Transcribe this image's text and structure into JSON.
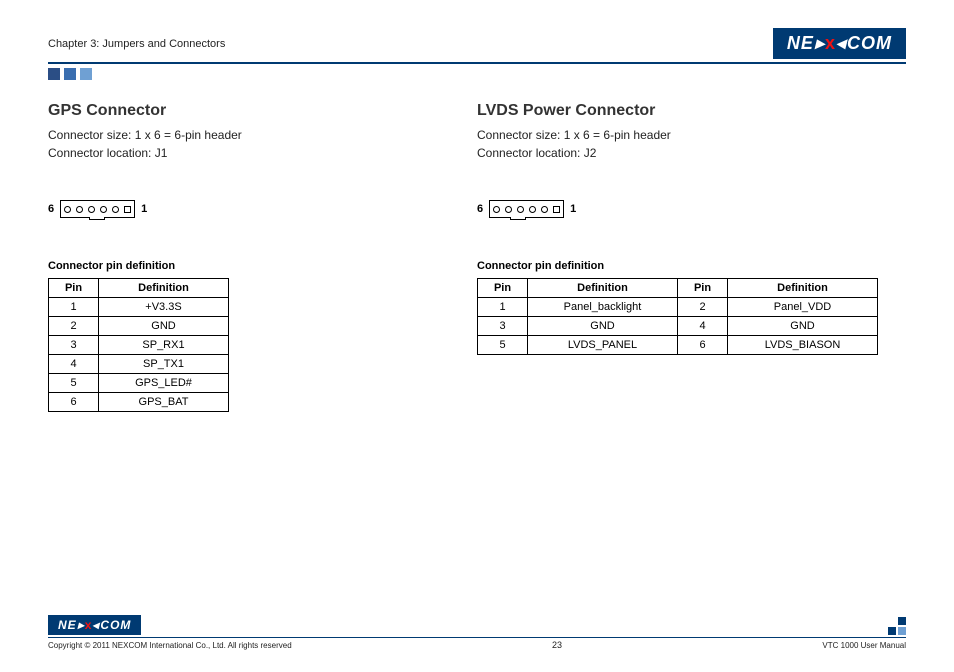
{
  "header": {
    "chapter": "Chapter 3: Jumpers and Connectors",
    "brand_ne": "NE",
    "brand_x": "X",
    "brand_com": "COM"
  },
  "left": {
    "title": "GPS Connector",
    "size": "Connector size: 1 x 6 = 6-pin header",
    "location": "Connector location: J1",
    "pin6": "6",
    "pin1": "1",
    "table_title": "Connector pin definition",
    "headers": {
      "pin": "Pin",
      "def": "Definition"
    },
    "rows": [
      {
        "pin": "1",
        "def": "+V3.3S"
      },
      {
        "pin": "2",
        "def": "GND"
      },
      {
        "pin": "3",
        "def": "SP_RX1"
      },
      {
        "pin": "4",
        "def": "SP_TX1"
      },
      {
        "pin": "5",
        "def": "GPS_LED#"
      },
      {
        "pin": "6",
        "def": "GPS_BAT"
      }
    ]
  },
  "right": {
    "title": "LVDS Power Connector",
    "size": "Connector size: 1 x 6 = 6-pin header",
    "location": "Connector location: J2",
    "pin6": "6",
    "pin1": "1",
    "table_title": "Connector pin definition",
    "headers": {
      "pin": "Pin",
      "def": "Definition"
    },
    "rows": [
      {
        "p1": "1",
        "d1": "Panel_backlight",
        "p2": "2",
        "d2": "Panel_VDD"
      },
      {
        "p1": "3",
        "d1": "GND",
        "p2": "4",
        "d2": "GND"
      },
      {
        "p1": "5",
        "d1": "LVDS_PANEL",
        "p2": "6",
        "d2": "LVDS_BIASON"
      }
    ]
  },
  "footer": {
    "copyright": "Copyright © 2011 NEXCOM International Co., Ltd. All rights reserved",
    "page": "23",
    "manual": "VTC 1000 User Manual"
  }
}
